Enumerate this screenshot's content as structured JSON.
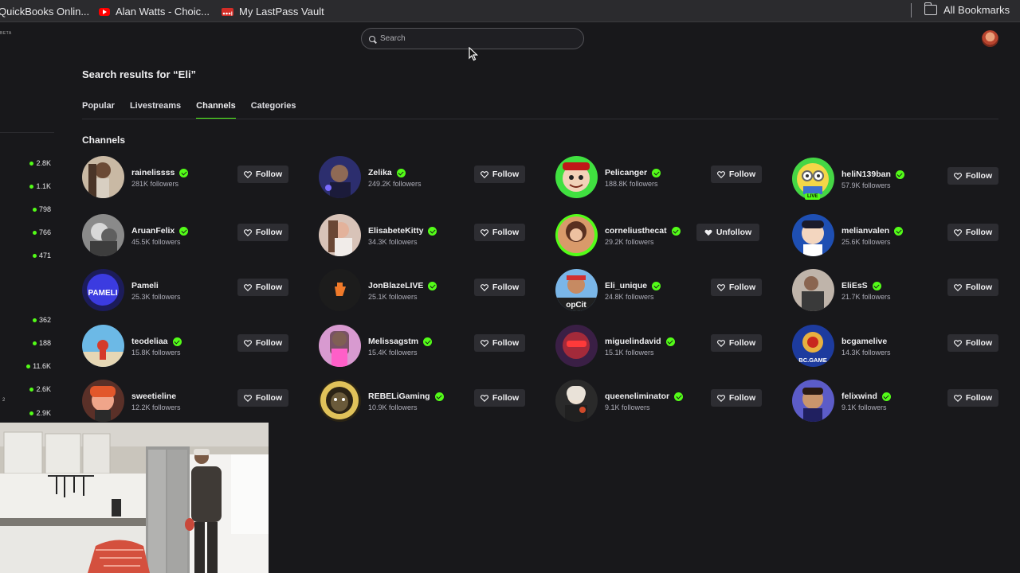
{
  "bookmarks": {
    "items": [
      {
        "label": "QuickBooks Onlin...",
        "icon": "quickbooks-icon"
      },
      {
        "label": "Alan Watts - Choic...",
        "icon": "youtube-icon"
      },
      {
        "label": "My LastPass Vault",
        "icon": "lastpass-icon"
      }
    ],
    "all_label": "All Bookmarks"
  },
  "header": {
    "beta": "BETA",
    "search_placeholder": "Search"
  },
  "page": {
    "title": "Search results for “Eli”",
    "tabs": [
      {
        "label": "Popular",
        "active": false
      },
      {
        "label": "Livestreams",
        "active": false
      },
      {
        "label": "Channels",
        "active": true
      },
      {
        "label": "Categories",
        "active": false
      }
    ],
    "section_title": "Channels"
  },
  "sidebar_counts": [
    "2.8K",
    "1.1K",
    "798",
    "766",
    "471",
    "362",
    "188",
    "11.6K",
    "2.6K",
    "2.9K"
  ],
  "sidebar_small": "2",
  "channels": [
    {
      "name": "rainelissss",
      "followers": "281K followers",
      "button": "Follow",
      "verified": true
    },
    {
      "name": "Zelika",
      "followers": "249.2K followers",
      "button": "Follow",
      "verified": true
    },
    {
      "name": "Pelicanger",
      "followers": "188.8K followers",
      "button": "Follow",
      "verified": true
    },
    {
      "name": "heliN139ban",
      "followers": "57.9K followers",
      "button": "Follow",
      "verified": true,
      "live": "LIVE"
    },
    {
      "name": "AruanFelix",
      "followers": "45.5K followers",
      "button": "Follow",
      "verified": true
    },
    {
      "name": "ElisabeteKitty",
      "followers": "34.3K followers",
      "button": "Follow",
      "verified": true
    },
    {
      "name": "corneliusthecat",
      "followers": "29.2K followers",
      "button": "Unfollow",
      "verified": true
    },
    {
      "name": "melianvalen",
      "followers": "25.6K followers",
      "button": "Follow",
      "verified": true
    },
    {
      "name": "Pameli",
      "followers": "25.3K followers",
      "button": "Follow",
      "verified": false
    },
    {
      "name": "JonBlazeLIVE",
      "followers": "25.1K followers",
      "button": "Follow",
      "verified": true
    },
    {
      "name": "Eli_unique",
      "followers": "24.8K followers",
      "button": "Follow",
      "verified": true
    },
    {
      "name": "EliEsS",
      "followers": "21.7K followers",
      "button": "Follow",
      "verified": true
    },
    {
      "name": "teodeliaa",
      "followers": "15.8K followers",
      "button": "Follow",
      "verified": true
    },
    {
      "name": "Melissagstm",
      "followers": "15.4K followers",
      "button": "Follow",
      "verified": true
    },
    {
      "name": "miguelindavid",
      "followers": "15.1K followers",
      "button": "Follow",
      "verified": true
    },
    {
      "name": "bcgamelive",
      "followers": "14.3K followers",
      "button": "Follow",
      "verified": false
    },
    {
      "name": "sweetieline",
      "followers": "12.2K followers",
      "button": "Follow",
      "verified": false
    },
    {
      "name": "REBELiGaming",
      "followers": "10.9K followers",
      "button": "Follow",
      "verified": true
    },
    {
      "name": "queeneliminator",
      "followers": "9.1K followers",
      "button": "Follow",
      "verified": true
    },
    {
      "name": "felixwind",
      "followers": "9.1K followers",
      "button": "Follow",
      "verified": true
    }
  ],
  "avatar_texts": {
    "pameli": "PAMELI",
    "eli_unique": "opCit",
    "bcgame": "BC.GAME"
  },
  "colors": {
    "accent": "#53fc18",
    "background": "#18181b",
    "button": "#2d2d32"
  }
}
